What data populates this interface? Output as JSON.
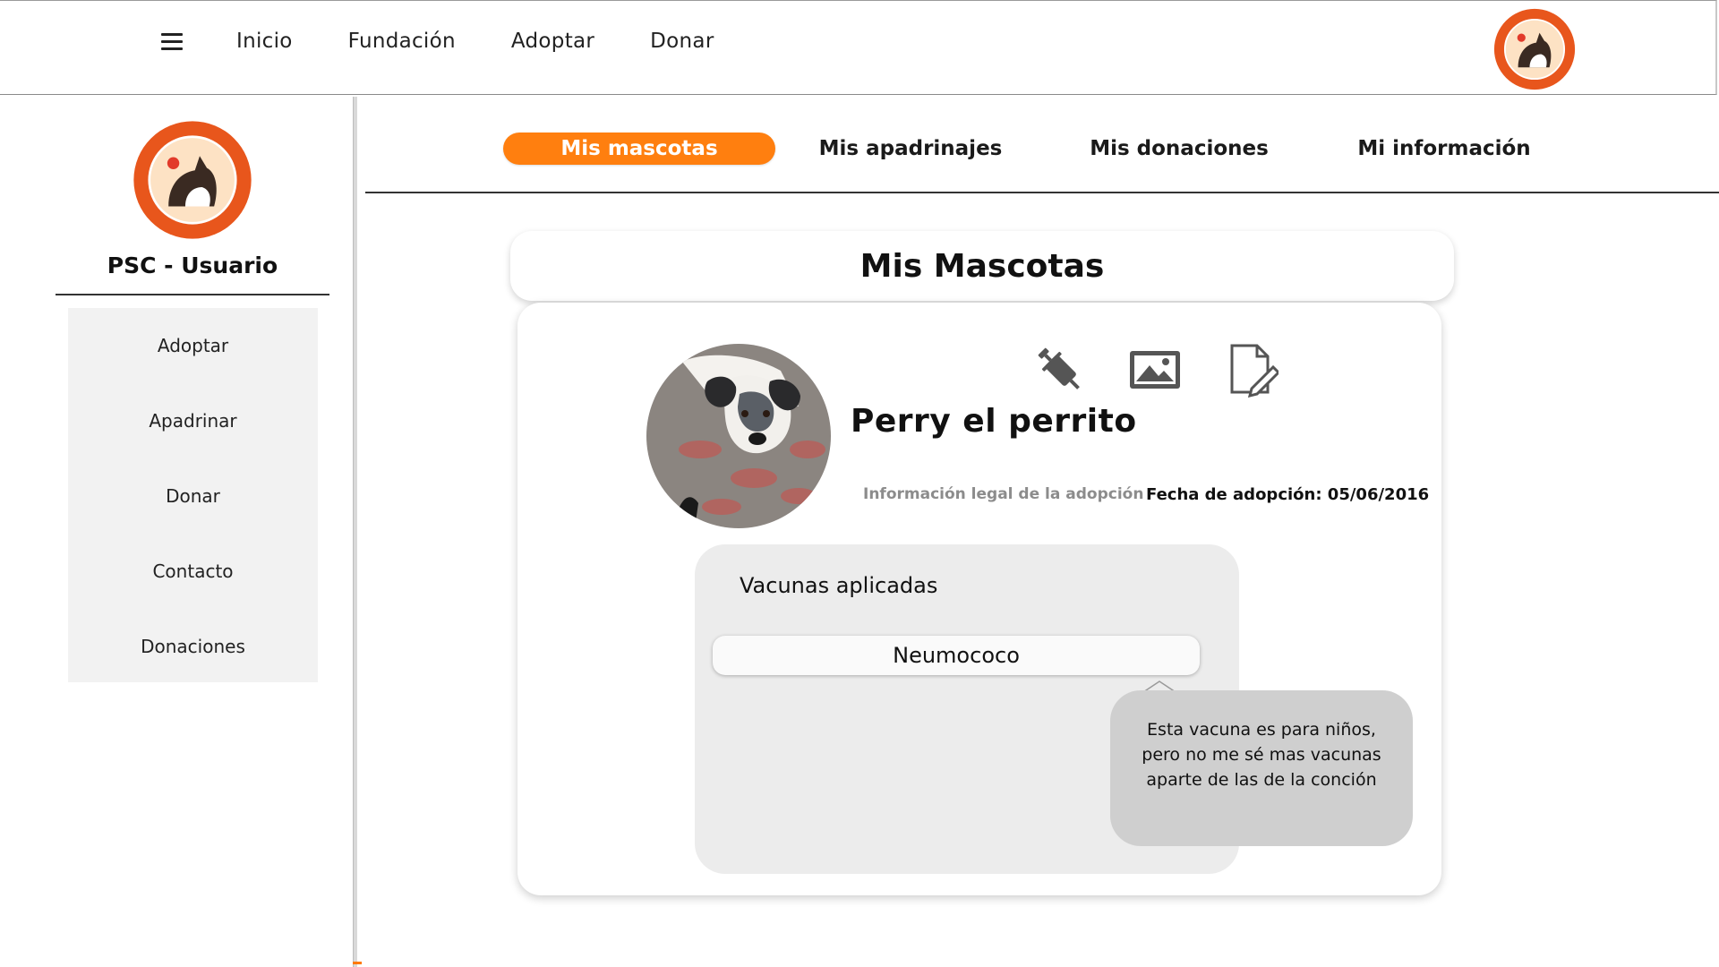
{
  "topnav": {
    "menu_icon": "hamburger-menu-icon",
    "items": [
      "Inicio",
      "Fundación",
      "Adoptar",
      "Donar"
    ],
    "logo_icon": "peluditos-san-cristobal-logo-icon"
  },
  "sidebar": {
    "title": "PSC - Usuario",
    "items": [
      "Adoptar",
      "Apadrinar",
      "Donar",
      "Contacto",
      "Donaciones"
    ]
  },
  "tabs": [
    {
      "label": "Mis mascotas",
      "active": true
    },
    {
      "label": "Mis apadrinajes",
      "active": false
    },
    {
      "label": "Mis donaciones",
      "active": false
    },
    {
      "label": "Mi información",
      "active": false
    }
  ],
  "main": {
    "title": "Mis Mascotas",
    "pet": {
      "name": "Perry el perrito",
      "legal_link": "Información legal de la adopción",
      "adoption_date": "Fecha de adopción: 05/06/2016",
      "actions": [
        "syringe-icon",
        "image-icon",
        "edit-document-icon"
      ]
    },
    "vaccines": {
      "title": "Vacunas aplicadas",
      "items": [
        "Neumococo"
      ],
      "tooltip": "Esta vacuna es para niños, pero no me sé mas vacunas aparte de las de la conción"
    }
  },
  "colors": {
    "accent": "#ff7f0f",
    "panel_gray": "#ececec",
    "tooltip_gray": "#cfcfcf",
    "logo_orange": "#e8561c",
    "logo_cream": "#fde2c4"
  }
}
